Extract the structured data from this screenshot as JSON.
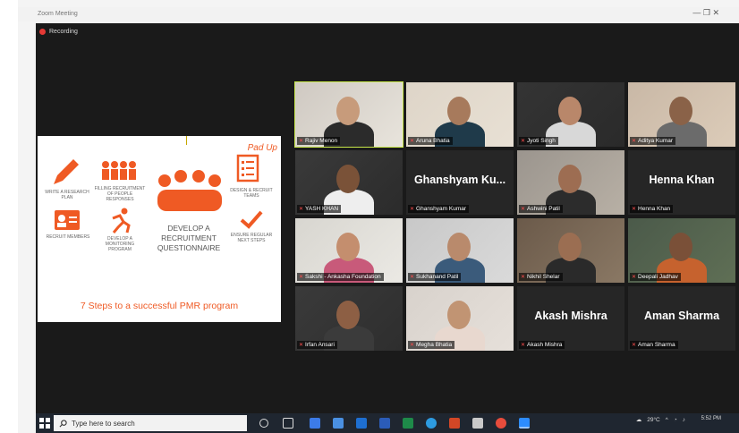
{
  "window": {
    "title": "Zoom Meeting",
    "controls": "—   ❐   ✕"
  },
  "meeting": {
    "recording_label": "Recording"
  },
  "slide": {
    "tag": "Pad Up",
    "steps": [
      "Write a research plan",
      "Filling recruitment of people responses",
      "Develop a monitoring program",
      "Design & recruit teams",
      "Ensure regular next steps",
      "Recruit members"
    ],
    "center_title": "DEVELOP A RECRUITMENT QUESTIONNAIRE",
    "caption": "7 Steps to a successful PMR program"
  },
  "participants": [
    {
      "name": "Rajiv Menon",
      "video": true,
      "active": true
    },
    {
      "name": "Aruna Bhatia",
      "video": true
    },
    {
      "name": "Jyoti Singh",
      "video": true
    },
    {
      "name": "Aditya Kumar",
      "video": true
    },
    {
      "name": "YASH KHAN",
      "video": true
    },
    {
      "name": "Ghanshyam Kumar",
      "video": false,
      "display": "Ghanshyam  Ku..."
    },
    {
      "name": "Ashwini Patil",
      "video": true
    },
    {
      "name": "Henna Khan",
      "video": false,
      "display": "Henna Khan"
    },
    {
      "name": "Sakshi - Ankasha Foundation",
      "video": true
    },
    {
      "name": "Sukhanand Patil",
      "video": true
    },
    {
      "name": "Nikhil Shelar",
      "video": true
    },
    {
      "name": "Deepali Jadhav",
      "video": true
    },
    {
      "name": "Irfan Ansari",
      "video": true
    },
    {
      "name": "Megha Bhatia",
      "video": true
    },
    {
      "name": "Akash Mishra",
      "video": false,
      "display": "Akash Mishra"
    },
    {
      "name": "Aman Sharma",
      "video": false,
      "display": "Aman Sharma"
    }
  ],
  "taskbar": {
    "search_placeholder": "Type here to search",
    "tray_text": "29°C",
    "time": "5:52 PM",
    "date": ""
  }
}
